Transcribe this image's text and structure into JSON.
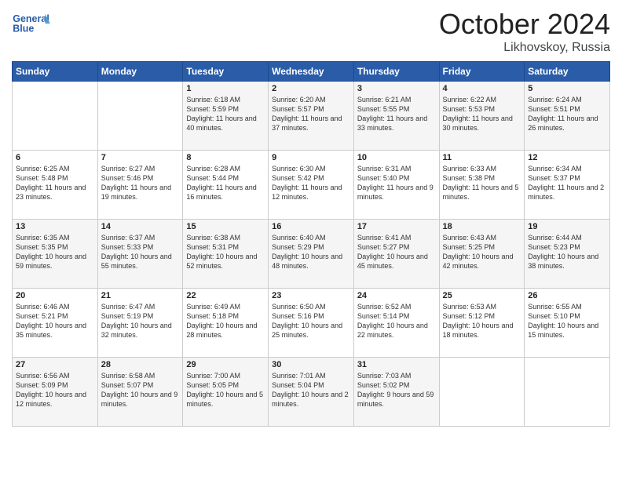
{
  "header": {
    "logo_line1": "General",
    "logo_line2": "Blue",
    "month": "October 2024",
    "location": "Likhovskoy, Russia"
  },
  "days_of_week": [
    "Sunday",
    "Monday",
    "Tuesday",
    "Wednesday",
    "Thursday",
    "Friday",
    "Saturday"
  ],
  "weeks": [
    [
      {
        "num": "",
        "sunrise": "",
        "sunset": "",
        "daylight": ""
      },
      {
        "num": "",
        "sunrise": "",
        "sunset": "",
        "daylight": ""
      },
      {
        "num": "1",
        "sunrise": "Sunrise: 6:18 AM",
        "sunset": "Sunset: 5:59 PM",
        "daylight": "Daylight: 11 hours and 40 minutes."
      },
      {
        "num": "2",
        "sunrise": "Sunrise: 6:20 AM",
        "sunset": "Sunset: 5:57 PM",
        "daylight": "Daylight: 11 hours and 37 minutes."
      },
      {
        "num": "3",
        "sunrise": "Sunrise: 6:21 AM",
        "sunset": "Sunset: 5:55 PM",
        "daylight": "Daylight: 11 hours and 33 minutes."
      },
      {
        "num": "4",
        "sunrise": "Sunrise: 6:22 AM",
        "sunset": "Sunset: 5:53 PM",
        "daylight": "Daylight: 11 hours and 30 minutes."
      },
      {
        "num": "5",
        "sunrise": "Sunrise: 6:24 AM",
        "sunset": "Sunset: 5:51 PM",
        "daylight": "Daylight: 11 hours and 26 minutes."
      }
    ],
    [
      {
        "num": "6",
        "sunrise": "Sunrise: 6:25 AM",
        "sunset": "Sunset: 5:48 PM",
        "daylight": "Daylight: 11 hours and 23 minutes."
      },
      {
        "num": "7",
        "sunrise": "Sunrise: 6:27 AM",
        "sunset": "Sunset: 5:46 PM",
        "daylight": "Daylight: 11 hours and 19 minutes."
      },
      {
        "num": "8",
        "sunrise": "Sunrise: 6:28 AM",
        "sunset": "Sunset: 5:44 PM",
        "daylight": "Daylight: 11 hours and 16 minutes."
      },
      {
        "num": "9",
        "sunrise": "Sunrise: 6:30 AM",
        "sunset": "Sunset: 5:42 PM",
        "daylight": "Daylight: 11 hours and 12 minutes."
      },
      {
        "num": "10",
        "sunrise": "Sunrise: 6:31 AM",
        "sunset": "Sunset: 5:40 PM",
        "daylight": "Daylight: 11 hours and 9 minutes."
      },
      {
        "num": "11",
        "sunrise": "Sunrise: 6:33 AM",
        "sunset": "Sunset: 5:38 PM",
        "daylight": "Daylight: 11 hours and 5 minutes."
      },
      {
        "num": "12",
        "sunrise": "Sunrise: 6:34 AM",
        "sunset": "Sunset: 5:37 PM",
        "daylight": "Daylight: 11 hours and 2 minutes."
      }
    ],
    [
      {
        "num": "13",
        "sunrise": "Sunrise: 6:35 AM",
        "sunset": "Sunset: 5:35 PM",
        "daylight": "Daylight: 10 hours and 59 minutes."
      },
      {
        "num": "14",
        "sunrise": "Sunrise: 6:37 AM",
        "sunset": "Sunset: 5:33 PM",
        "daylight": "Daylight: 10 hours and 55 minutes."
      },
      {
        "num": "15",
        "sunrise": "Sunrise: 6:38 AM",
        "sunset": "Sunset: 5:31 PM",
        "daylight": "Daylight: 10 hours and 52 minutes."
      },
      {
        "num": "16",
        "sunrise": "Sunrise: 6:40 AM",
        "sunset": "Sunset: 5:29 PM",
        "daylight": "Daylight: 10 hours and 48 minutes."
      },
      {
        "num": "17",
        "sunrise": "Sunrise: 6:41 AM",
        "sunset": "Sunset: 5:27 PM",
        "daylight": "Daylight: 10 hours and 45 minutes."
      },
      {
        "num": "18",
        "sunrise": "Sunrise: 6:43 AM",
        "sunset": "Sunset: 5:25 PM",
        "daylight": "Daylight: 10 hours and 42 minutes."
      },
      {
        "num": "19",
        "sunrise": "Sunrise: 6:44 AM",
        "sunset": "Sunset: 5:23 PM",
        "daylight": "Daylight: 10 hours and 38 minutes."
      }
    ],
    [
      {
        "num": "20",
        "sunrise": "Sunrise: 6:46 AM",
        "sunset": "Sunset: 5:21 PM",
        "daylight": "Daylight: 10 hours and 35 minutes."
      },
      {
        "num": "21",
        "sunrise": "Sunrise: 6:47 AM",
        "sunset": "Sunset: 5:19 PM",
        "daylight": "Daylight: 10 hours and 32 minutes."
      },
      {
        "num": "22",
        "sunrise": "Sunrise: 6:49 AM",
        "sunset": "Sunset: 5:18 PM",
        "daylight": "Daylight: 10 hours and 28 minutes."
      },
      {
        "num": "23",
        "sunrise": "Sunrise: 6:50 AM",
        "sunset": "Sunset: 5:16 PM",
        "daylight": "Daylight: 10 hours and 25 minutes."
      },
      {
        "num": "24",
        "sunrise": "Sunrise: 6:52 AM",
        "sunset": "Sunset: 5:14 PM",
        "daylight": "Daylight: 10 hours and 22 minutes."
      },
      {
        "num": "25",
        "sunrise": "Sunrise: 6:53 AM",
        "sunset": "Sunset: 5:12 PM",
        "daylight": "Daylight: 10 hours and 18 minutes."
      },
      {
        "num": "26",
        "sunrise": "Sunrise: 6:55 AM",
        "sunset": "Sunset: 5:10 PM",
        "daylight": "Daylight: 10 hours and 15 minutes."
      }
    ],
    [
      {
        "num": "27",
        "sunrise": "Sunrise: 6:56 AM",
        "sunset": "Sunset: 5:09 PM",
        "daylight": "Daylight: 10 hours and 12 minutes."
      },
      {
        "num": "28",
        "sunrise": "Sunrise: 6:58 AM",
        "sunset": "Sunset: 5:07 PM",
        "daylight": "Daylight: 10 hours and 9 minutes."
      },
      {
        "num": "29",
        "sunrise": "Sunrise: 7:00 AM",
        "sunset": "Sunset: 5:05 PM",
        "daylight": "Daylight: 10 hours and 5 minutes."
      },
      {
        "num": "30",
        "sunrise": "Sunrise: 7:01 AM",
        "sunset": "Sunset: 5:04 PM",
        "daylight": "Daylight: 10 hours and 2 minutes."
      },
      {
        "num": "31",
        "sunrise": "Sunrise: 7:03 AM",
        "sunset": "Sunset: 5:02 PM",
        "daylight": "Daylight: 9 hours and 59 minutes."
      },
      {
        "num": "",
        "sunrise": "",
        "sunset": "",
        "daylight": ""
      },
      {
        "num": "",
        "sunrise": "",
        "sunset": "",
        "daylight": ""
      }
    ]
  ]
}
